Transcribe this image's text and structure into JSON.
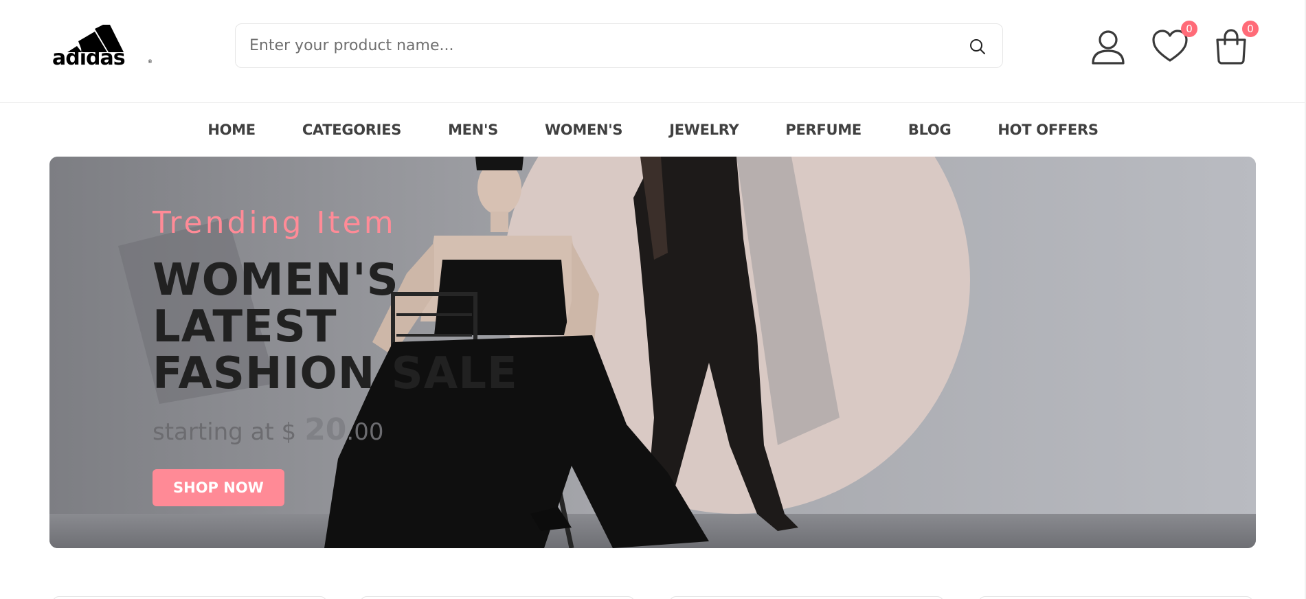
{
  "brand": {
    "logo_text": "adidas",
    "reg_mark": "®"
  },
  "search": {
    "placeholder": "Enter your product name...",
    "value": "",
    "icon": "search-icon"
  },
  "header_actions": {
    "account_icon": "user-icon",
    "wishlist": {
      "icon": "heart-icon",
      "count": "0"
    },
    "cart": {
      "icon": "shopping-bag-icon",
      "count": "0"
    },
    "badge_color": "#ff6b78"
  },
  "nav": {
    "items": [
      "HOME",
      "CATEGORIES",
      "MEN'S",
      "WOMEN'S",
      "JEWELRY",
      "PERFUME",
      "BLOG",
      "HOT OFFERS"
    ]
  },
  "hero": {
    "subtitle": "Trending Item",
    "title": "WOMEN'S LATEST FASHION SALE",
    "price_prefix": "starting at $",
    "price_whole": "20",
    "price_cents": ".00",
    "button_label": "SHOP NOW",
    "accent_color": "#ff8a96"
  },
  "category_cards": {
    "count_visible": 4
  }
}
